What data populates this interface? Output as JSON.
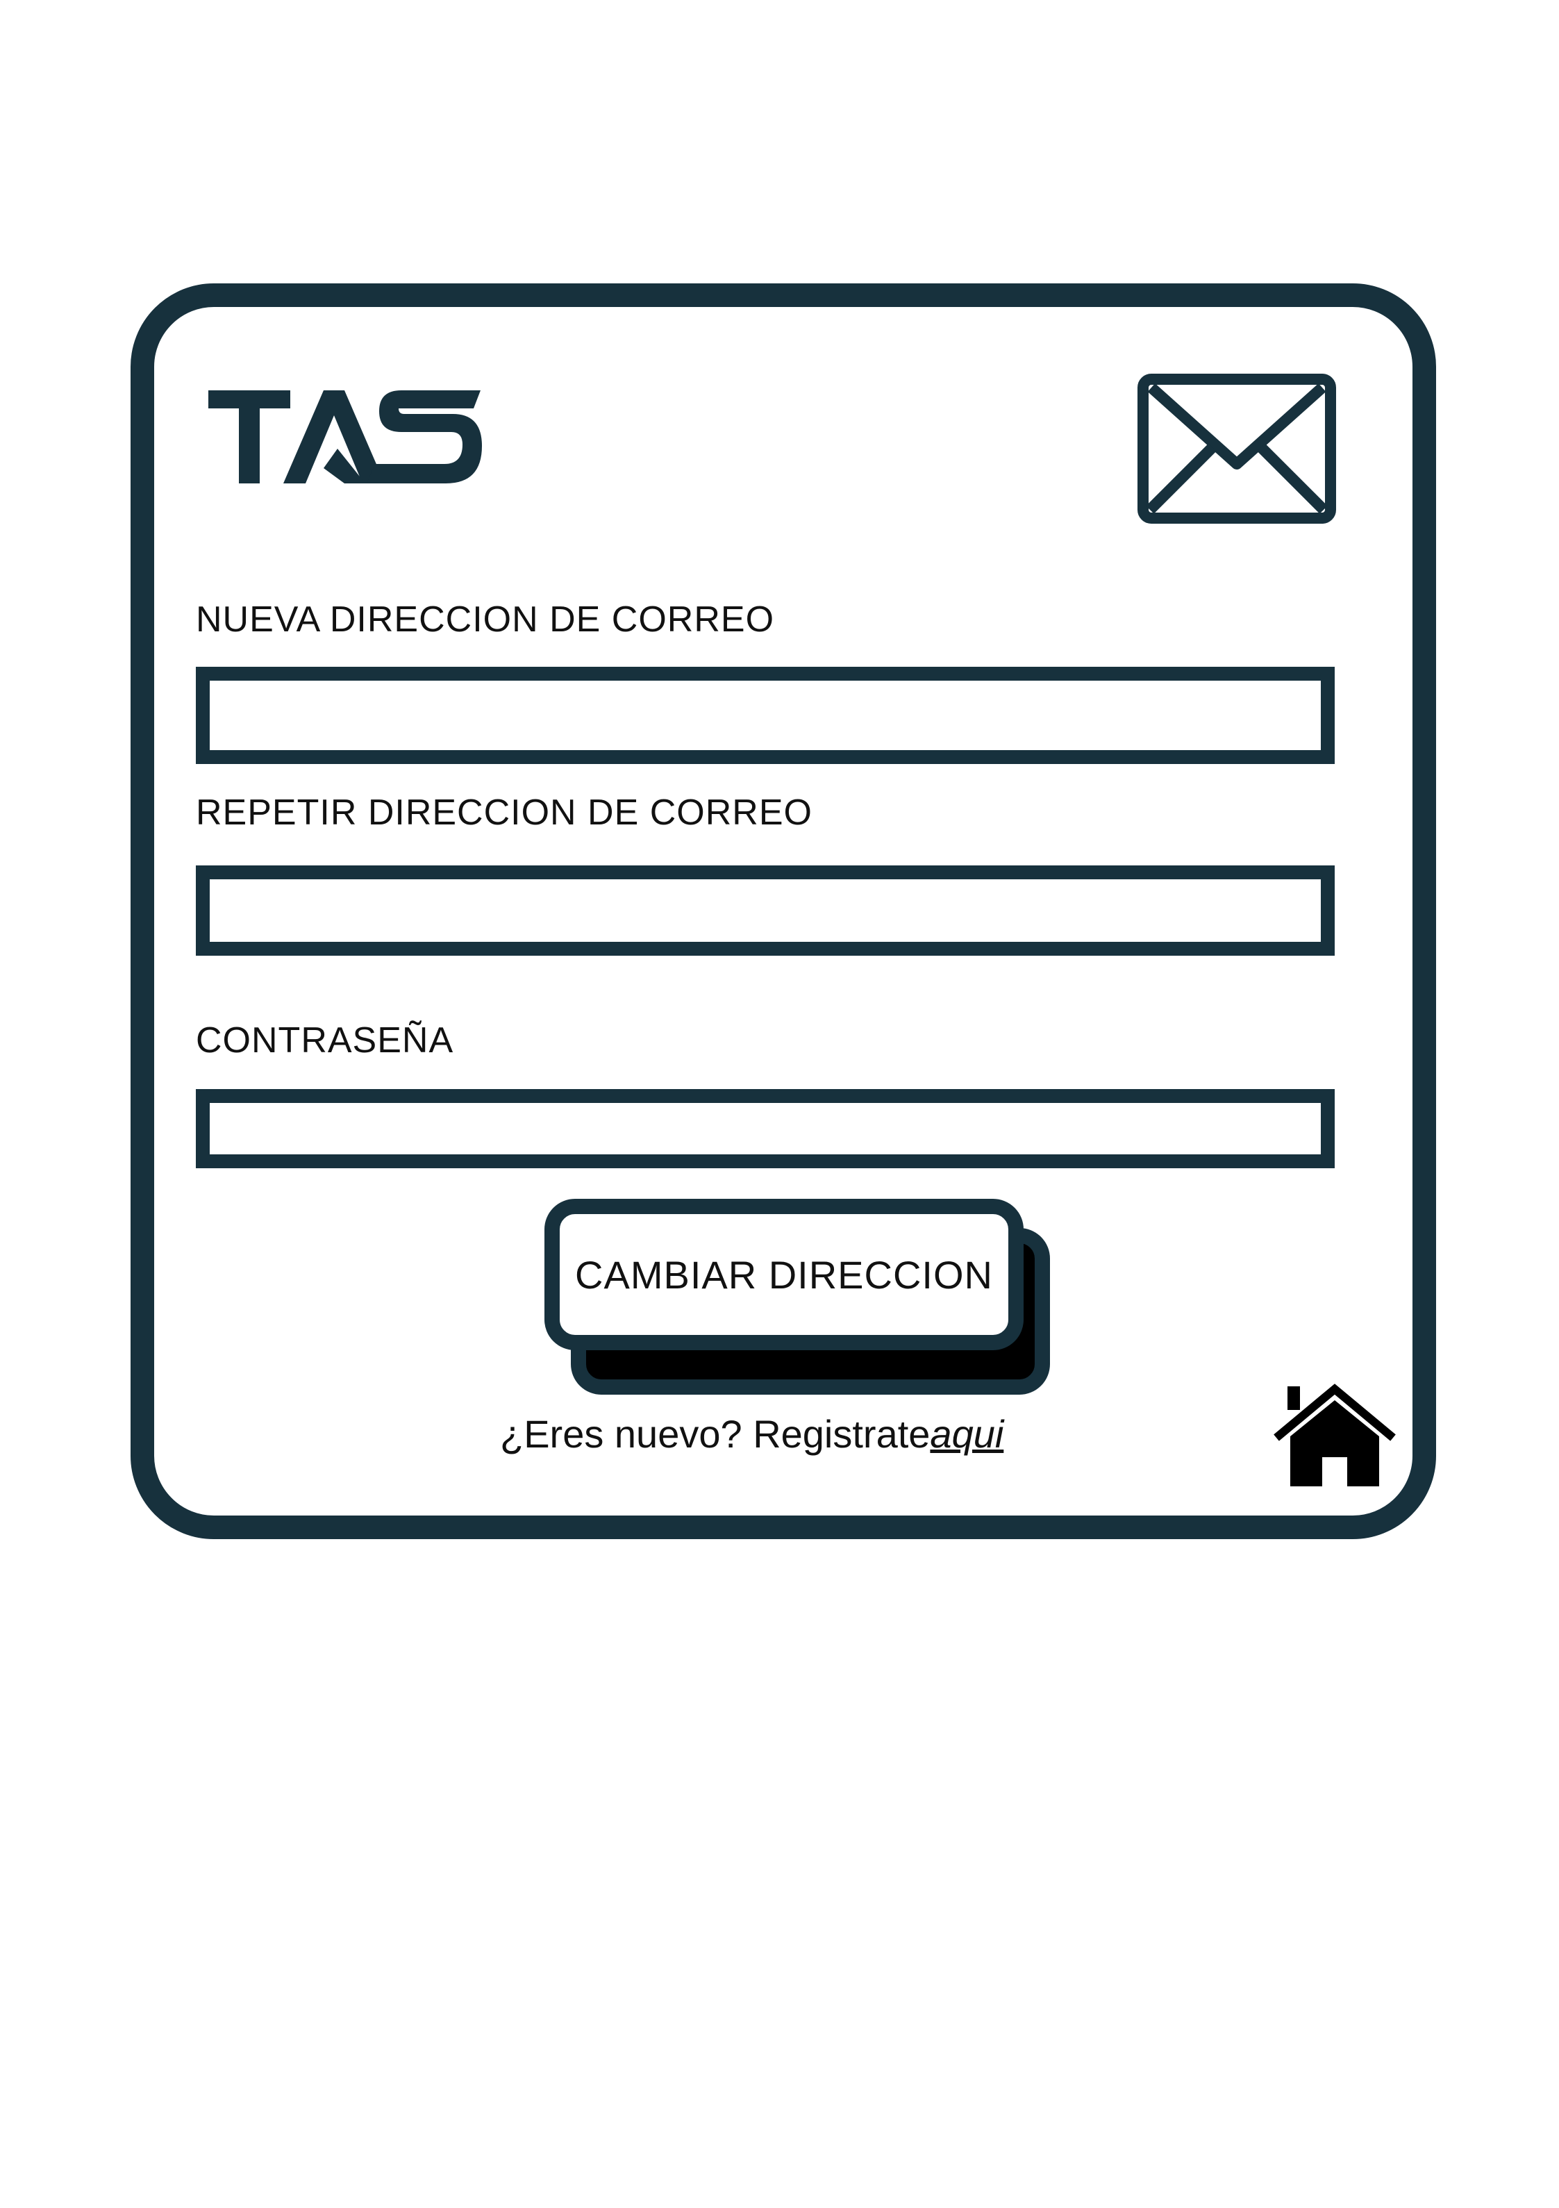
{
  "brand": {
    "logo_text": "TAS",
    "color": "#17313d"
  },
  "icons": {
    "header": "envelope-icon",
    "footer": "home-icon"
  },
  "form": {
    "new_email": {
      "label": "NUEVA DIRECCION DE CORREO",
      "value": ""
    },
    "repeat_email": {
      "label": "REPETIR DIRECCION DE CORREO",
      "value": ""
    },
    "password": {
      "label": "CONTRASEÑA",
      "value": ""
    },
    "submit_label": "CAMBIAR DIRECCION"
  },
  "register": {
    "prompt": "¿Eres nuevo?  Registrate",
    "link_text": "aqui"
  }
}
